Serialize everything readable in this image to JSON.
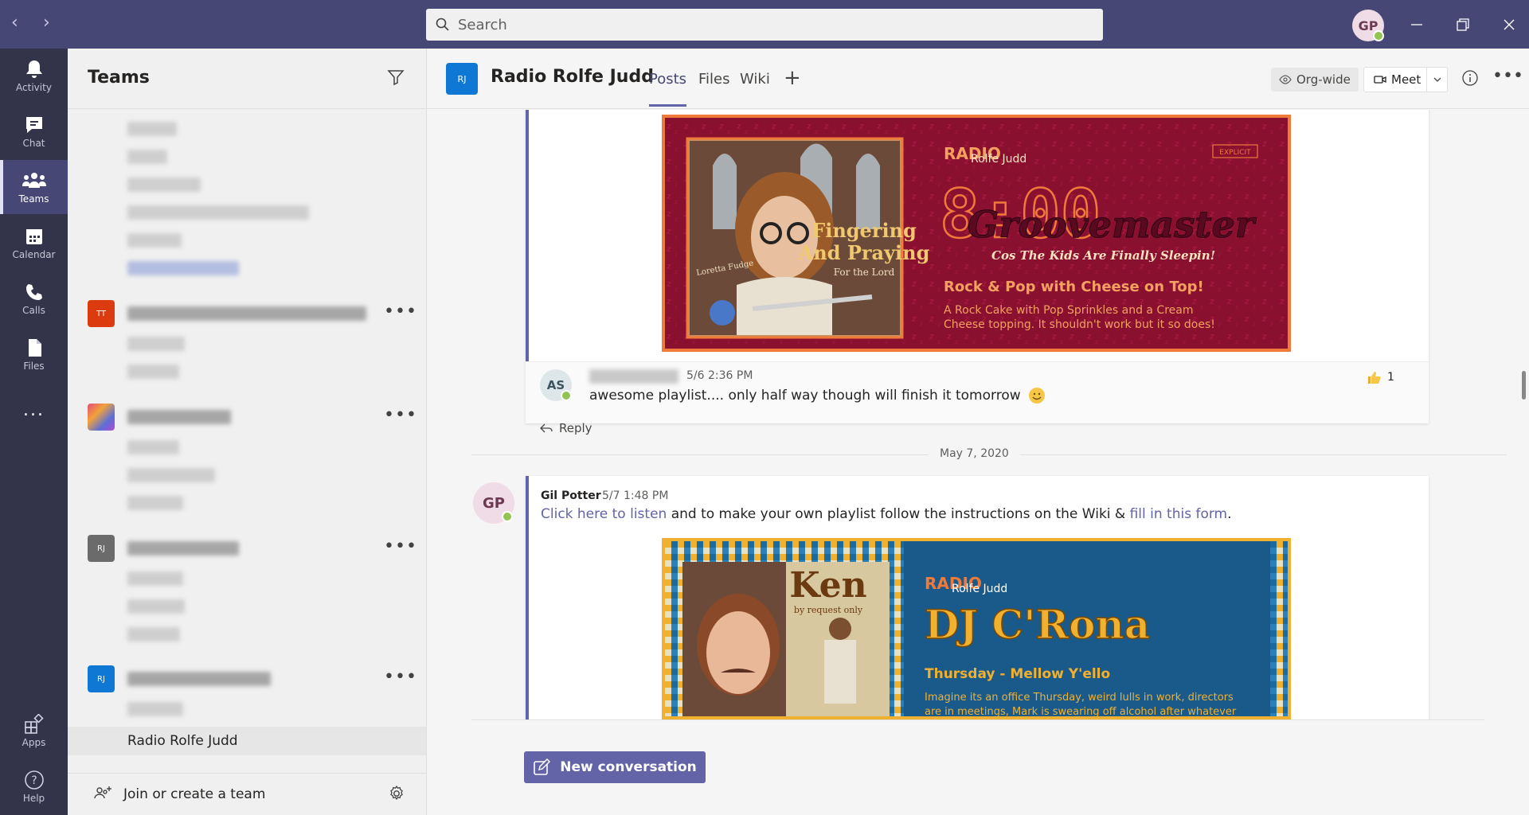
{
  "titlebar": {
    "search_placeholder": "Search",
    "user_initials": "GP"
  },
  "rail": {
    "items": [
      {
        "label": "Activity",
        "icon": "bell-icon"
      },
      {
        "label": "Chat",
        "icon": "chat-icon"
      },
      {
        "label": "Teams",
        "icon": "teams-icon",
        "active": true
      },
      {
        "label": "Calendar",
        "icon": "calendar-icon"
      },
      {
        "label": "Calls",
        "icon": "phone-icon"
      },
      {
        "label": "Files",
        "icon": "files-icon"
      },
      {
        "label": "Apps",
        "icon": "apps-icon"
      },
      {
        "label": "Help",
        "icon": "help-icon"
      }
    ],
    "more": "..."
  },
  "teams_panel": {
    "title": "Teams",
    "teams": [
      {
        "tile": "TT",
        "color": "#dc3b10"
      },
      {
        "tile": "",
        "color": "gradient"
      },
      {
        "tile": "RJ",
        "color": "#6b6b6b"
      },
      {
        "tile": "RJ",
        "color": "#0f78d4"
      }
    ],
    "selected_channel": "Radio Rolfe Judd",
    "join_label": "Join or create a team"
  },
  "channel": {
    "tile": "RJ",
    "name": "Radio Rolfe Judd",
    "tabs": [
      "Posts",
      "Files",
      "Wiki"
    ],
    "orgwide": "Org-wide",
    "meet": "Meet"
  },
  "banner1": {
    "radio": "RADIO",
    "station": "Rolfe Judd",
    "explicit": "EXPLICIT",
    "time": "8:00",
    "show": "Groovemaster",
    "tagline": "Cos The Kids Are Finally Sleepin!",
    "headline": "Rock & Pop with Cheese on Top!",
    "desc1": "A Rock Cake with Pop Sprinkles and a Cream",
    "desc2": "Cheese topping. It shouldn't work but it so does!",
    "album_title1": "Fingering",
    "album_title2": "And Praying",
    "album_sub": "For the Lord",
    "album_artist": "Loretta Fudge"
  },
  "reply": {
    "initials": "AS",
    "time": "5/6 2:36 PM",
    "text": "awesome playlist.... only half way though will finish it tomorrow",
    "reaction_count": "1",
    "reply_label": "Reply"
  },
  "date_divider": "May 7, 2020",
  "post2": {
    "initials": "GP",
    "author": "Gil Potter",
    "time": "5/7 1:48 PM",
    "link1": "Click here to listen",
    "text_mid": " and to make your own playlist follow the instructions on the Wiki & ",
    "link2": "fill in this form",
    "text_end": "."
  },
  "banner2": {
    "radio": "RADIO",
    "station": "Rolfe Judd",
    "album_title": "Ken",
    "album_sub": "by request only",
    "show": "DJ C'Rona",
    "headline": "Thursday - Mellow Y'ello",
    "desc1": "Imagine its an office Thursday, weird lulls in work, directors",
    "desc2": "are in meetings, Mark is swearing off alcohol after whatever"
  },
  "composer": {
    "new_conversation": "New conversation"
  }
}
